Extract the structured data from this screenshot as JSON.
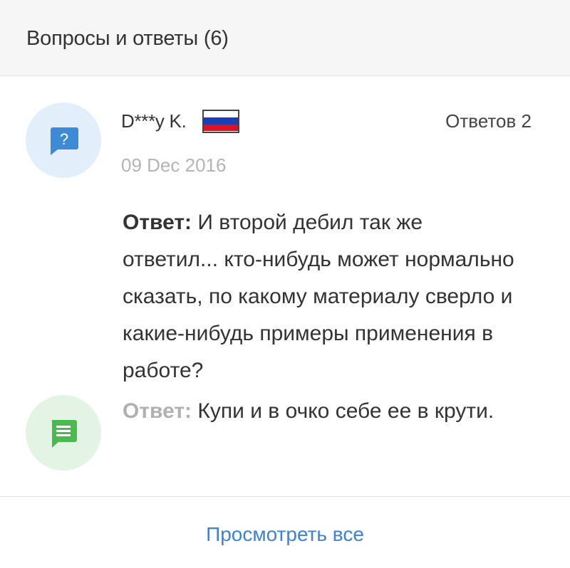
{
  "header": {
    "title": "Вопросы и ответы (6)"
  },
  "question": {
    "user": "D***y K.",
    "flag_icon": "russia-flag-icon",
    "answers_count": "Ответов 2",
    "date": "09 Dec 2016",
    "label": "Ответ:",
    "text": "И второй дебил так же ответил... кто-нибудь может нормально сказать, по какому материалу сверло и какие-нибудь примеры применения в работе?",
    "avatar_icon": "question-bubble-icon"
  },
  "reply": {
    "label": "Ответ:",
    "text": "Купи и в очко себе ее в крути.",
    "avatar_icon": "message-bubble-icon"
  },
  "footer": {
    "view_all": "Просмотреть все"
  },
  "colors": {
    "header_bg": "#f6f6f6",
    "question_avatar_bg": "#e2eef9",
    "question_icon": "#3d8ad6",
    "answer_avatar_bg": "#e3f4e4",
    "answer_icon": "#4ab94e",
    "link": "#3b82d8"
  }
}
